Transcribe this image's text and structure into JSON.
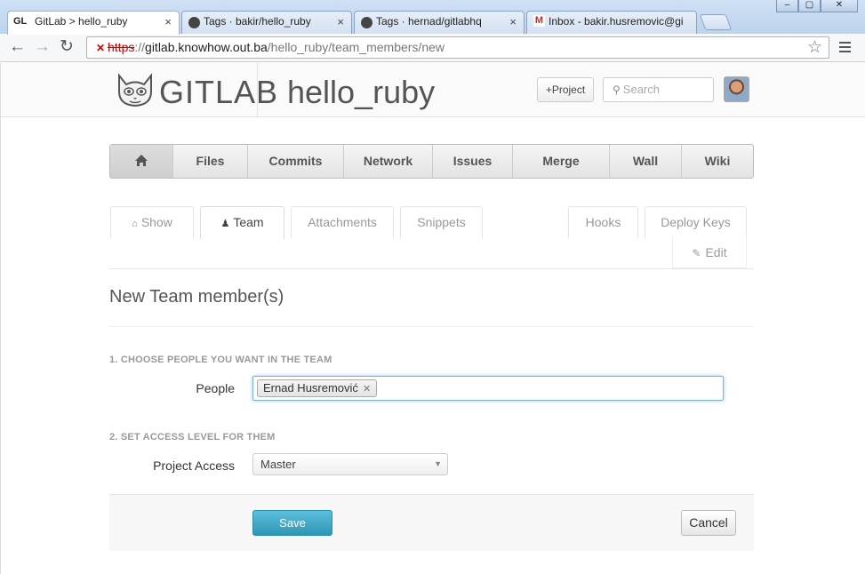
{
  "browser": {
    "tabs": [
      {
        "favicon": "GL",
        "title": "GitLab > hello_ruby",
        "active": true
      },
      {
        "favicon": "github-icon",
        "title": "Tags · bakir/hello_ruby",
        "active": false
      },
      {
        "favicon": "github-icon",
        "title": "Tags · hernad/gitlabhq",
        "active": false
      },
      {
        "favicon": "gmail-icon",
        "title": "Inbox - bakir.husremovic@gi",
        "active": false
      }
    ],
    "close_glyph": "×",
    "window_buttons": [
      "–",
      "▢",
      "✕"
    ],
    "url": {
      "scheme": "https",
      "separator": "://",
      "host": "gitlab.knowhow.out.ba",
      "path": "/hello_ruby/team_members/new"
    }
  },
  "header": {
    "brand": "GITLAB",
    "project": "hello_ruby",
    "new_project_label": "Project",
    "search_placeholder": "Search"
  },
  "main_nav": [
    {
      "label": "",
      "icon": "home-icon"
    },
    {
      "label": "Files"
    },
    {
      "label": "Commits"
    },
    {
      "label": "Network"
    },
    {
      "label": "Issues"
    },
    {
      "label": "Merge"
    },
    {
      "label": "Wall"
    },
    {
      "label": "Wiki"
    }
  ],
  "sub_nav": {
    "left": [
      {
        "label": "Show",
        "icon": "home-icon"
      },
      {
        "label": "Team",
        "icon": "user-icon",
        "active": true
      },
      {
        "label": "Attachments"
      },
      {
        "label": "Snippets"
      }
    ],
    "right": [
      {
        "label": "Hooks"
      },
      {
        "label": "Deploy Keys"
      }
    ],
    "edit": {
      "label": "Edit",
      "icon": "edit-icon"
    }
  },
  "form": {
    "title": "New Team member(s)",
    "section1": "1. CHOOSE PEOPLE YOU WANT IN THE TEAM",
    "people_label": "People",
    "people_selected": [
      "Ernad Husremović"
    ],
    "section2": "2. SET ACCESS LEVEL FOR THEM",
    "access_label": "Project Access",
    "access_value": "Master",
    "save_label": "Save",
    "cancel_label": "Cancel"
  }
}
